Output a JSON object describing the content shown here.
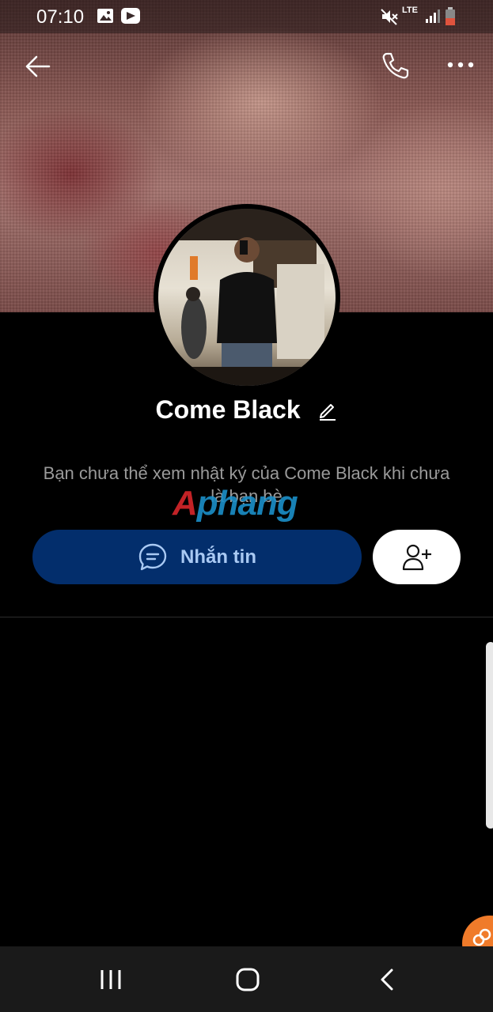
{
  "status_bar": {
    "time": "07:10",
    "network": "LTE",
    "icons": [
      "gallery-icon",
      "youtube-icon",
      "mute-icon",
      "signal-icon",
      "battery-icon"
    ]
  },
  "header": {
    "back_icon": "arrow-left-icon",
    "call_icon": "phone-icon",
    "more_icon": "more-horizontal-icon"
  },
  "profile": {
    "name": "Come Black",
    "edit_icon": "pencil-icon",
    "notice": "Bạn chưa thể xem nhật ký của Come Black khi chưa là bạn bè"
  },
  "watermark": {
    "first": "A",
    "rest": "phang"
  },
  "actions": {
    "message_label": "Nhắn tin",
    "message_icon": "chat-bubble-icon",
    "add_friend_icon": "add-user-icon"
  },
  "colors": {
    "message_button": "#032e6c",
    "message_text": "#a9c9f3",
    "background": "#000000",
    "float_bubble": "#f07b2a"
  },
  "nav_bar": {
    "icons": [
      "recent-apps-icon",
      "home-icon",
      "back-icon"
    ]
  }
}
